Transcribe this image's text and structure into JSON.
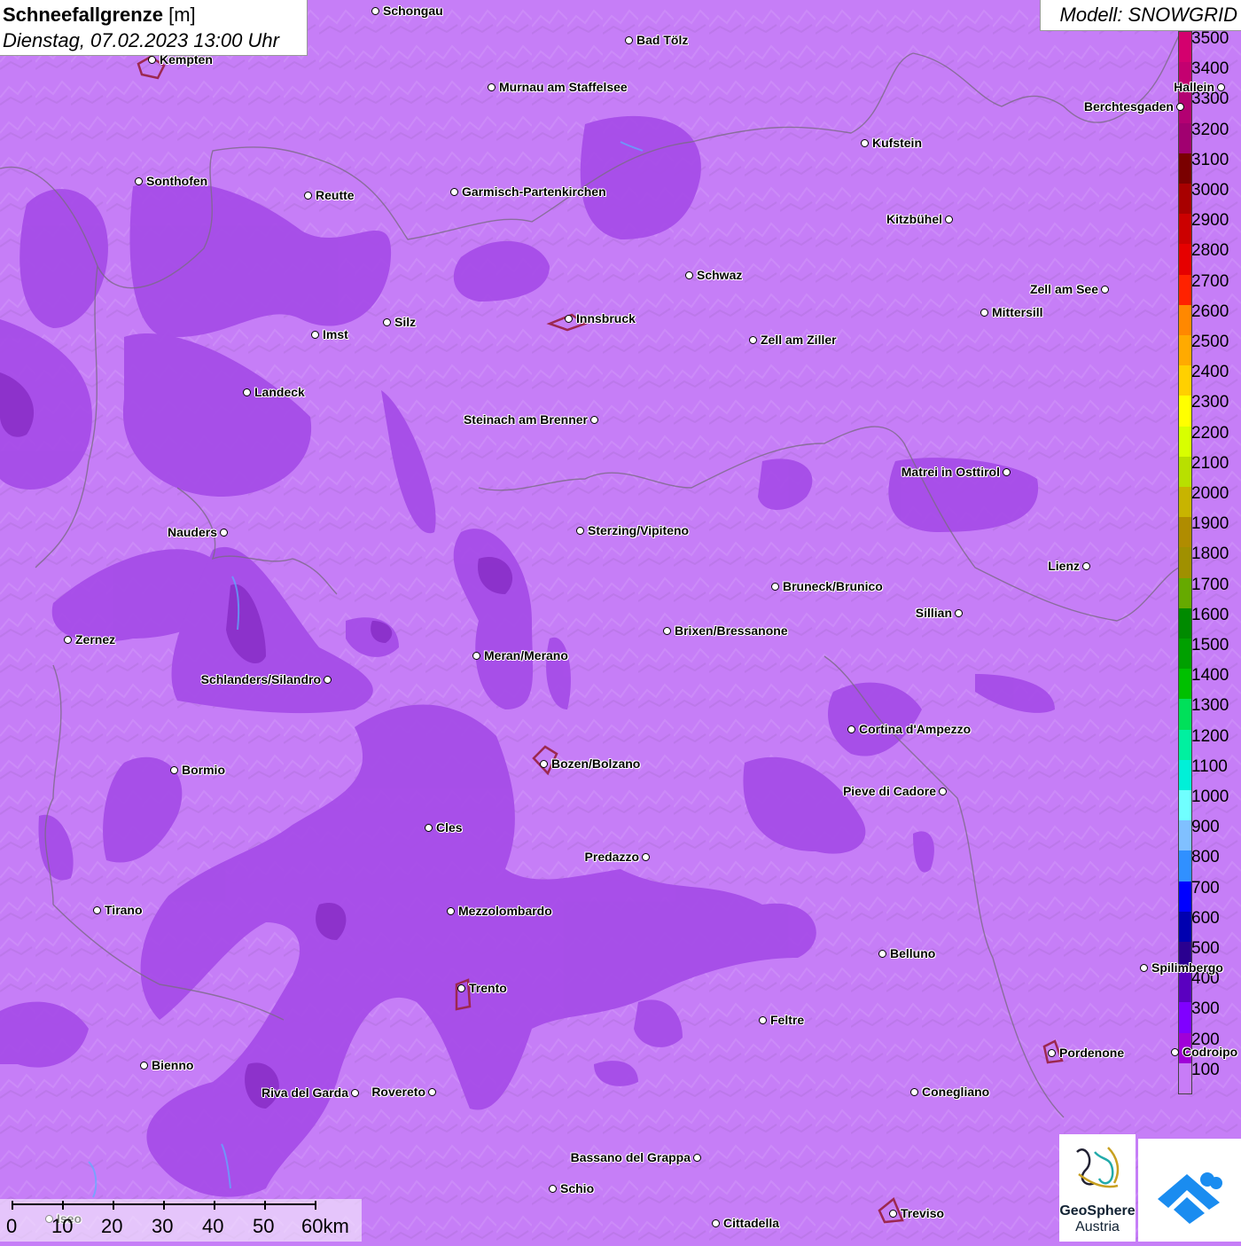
{
  "header": {
    "title": "Schneefallgrenze",
    "unit": "[m]",
    "datetime": "Dienstag, 07.02.2023 13:00 Uhr",
    "model": "Modell: SNOWGRID"
  },
  "legend": {
    "values": [
      "3500",
      "3400",
      "3300",
      "3200",
      "3100",
      "3000",
      "2900",
      "2800",
      "2700",
      "2600",
      "2500",
      "2400",
      "2300",
      "2200",
      "2100",
      "2000",
      "1900",
      "1800",
      "1700",
      "1600",
      "1500",
      "1400",
      "1300",
      "1200",
      "1100",
      "1000",
      "900",
      "800",
      "700",
      "600",
      "500",
      "400",
      "300",
      "200",
      "100"
    ],
    "colors": [
      "#d4006e",
      "#c40070",
      "#b30072",
      "#a10070",
      "#7a0000",
      "#a80000",
      "#cc0000",
      "#e60000",
      "#ff2200",
      "#ff8800",
      "#ffaa00",
      "#ffd000",
      "#ffff00",
      "#d8ff00",
      "#b8e000",
      "#c8b400",
      "#b08c00",
      "#a09000",
      "#66aa00",
      "#008a00",
      "#00a000",
      "#00c000",
      "#00e05a",
      "#00f0a0",
      "#00f0d8",
      "#70ffff",
      "#80c0ff",
      "#3090ff",
      "#0000ff",
      "#0000b0",
      "#2a0090",
      "#5a00c0",
      "#8000ff",
      "#a000d8",
      "#c87cf7"
    ]
  },
  "cities": [
    {
      "name": "Schongau"
    },
    {
      "name": "Bad Tölz"
    },
    {
      "name": "Kempten"
    },
    {
      "name": "Murnau am Staffelsee"
    },
    {
      "name": "Berchtesgaden"
    },
    {
      "name": "Kufstein"
    },
    {
      "name": "Sonthofen"
    },
    {
      "name": "Reutte"
    },
    {
      "name": "Garmisch-Partenkirchen"
    },
    {
      "name": "Kitzbühel"
    },
    {
      "name": "Schwaz"
    },
    {
      "name": "Zell am See"
    },
    {
      "name": "Innsbruck"
    },
    {
      "name": "Mittersill"
    },
    {
      "name": "Imst"
    },
    {
      "name": "Silz"
    },
    {
      "name": "Zell am Ziller"
    },
    {
      "name": "Landeck"
    },
    {
      "name": "Steinach am Brenner"
    },
    {
      "name": "Matrei in Osttirol"
    },
    {
      "name": "Nauders"
    },
    {
      "name": "Sterzing/Vipiteno"
    },
    {
      "name": "Lienz"
    },
    {
      "name": "Bruneck/Brunico"
    },
    {
      "name": "Sillian"
    },
    {
      "name": "Brixen/Bressanone"
    },
    {
      "name": "Zernez"
    },
    {
      "name": "Meran/Merano"
    },
    {
      "name": "Schlanders/Silandro"
    },
    {
      "name": "Cortina d'Ampezzo"
    },
    {
      "name": "Bozen/Bolzano"
    },
    {
      "name": "Bormio"
    },
    {
      "name": "Pieve di Cadore"
    },
    {
      "name": "Cles"
    },
    {
      "name": "Predazzo"
    },
    {
      "name": "Tirano"
    },
    {
      "name": "Mezzolombardo"
    },
    {
      "name": "Belluno"
    },
    {
      "name": "Spilimbergo"
    },
    {
      "name": "Trento"
    },
    {
      "name": "Feltre"
    },
    {
      "name": "Pordenone"
    },
    {
      "name": "Bienno"
    },
    {
      "name": "Riva del Garda"
    },
    {
      "name": "Rovereto"
    },
    {
      "name": "Conegliano"
    },
    {
      "name": "Bassano del Grappa"
    },
    {
      "name": "Schio"
    },
    {
      "name": "Treviso"
    },
    {
      "name": "Cittadella"
    },
    {
      "name": "Hallein"
    },
    {
      "name": "Codroipo"
    },
    {
      "name": "Iseo"
    }
  ],
  "scale": {
    "labels": [
      "0",
      "10",
      "20",
      "30",
      "40",
      "50",
      "60km"
    ]
  },
  "logos": {
    "geosphere_line1": "GeoSphere",
    "geosphere_line2": "Austria"
  },
  "colors": {
    "base": "#c67ef7",
    "mid": "#a64de8",
    "dark": "#8a2fc8",
    "darkest": "#6a1aa0"
  }
}
